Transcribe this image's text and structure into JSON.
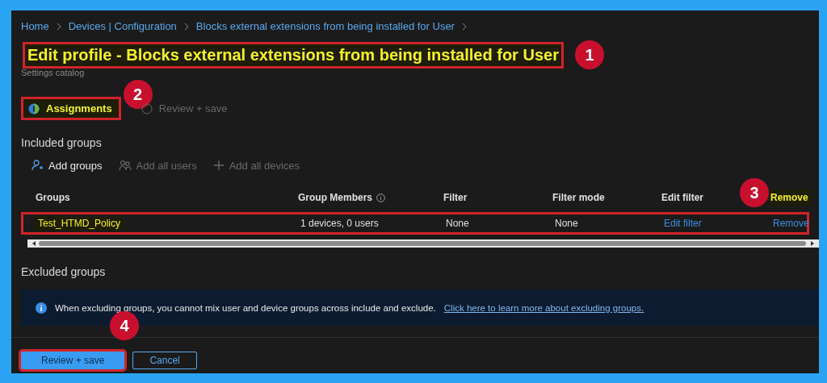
{
  "breadcrumb": [
    {
      "label": "Home"
    },
    {
      "label": "Devices | Configuration"
    },
    {
      "label": "Blocks external extensions from being installed for User"
    }
  ],
  "title": {
    "text": "Edit profile - Blocks external extensions from being installed for User",
    "highlighted": true,
    "boxed": true,
    "callout": "1"
  },
  "subtitle": "Settings catalog",
  "tabs": [
    {
      "label": "Assignments",
      "selected": true,
      "highlighted": true,
      "boxed": true,
      "callout": "2"
    },
    {
      "label": "Review + save",
      "selected": false,
      "highlighted": false,
      "boxed": false
    }
  ],
  "included": {
    "heading": "Included groups",
    "toolbar": [
      {
        "label": "Add groups",
        "kind": "person",
        "disabled": false
      },
      {
        "label": "Add all users",
        "kind": "people",
        "disabled": true
      },
      {
        "label": "Add all devices",
        "kind": "plus",
        "disabled": true
      }
    ],
    "columns": [
      {
        "label": "Groups",
        "highlighted": false
      },
      {
        "label": "Group Members",
        "info": true,
        "highlighted": false
      },
      {
        "label": "Filter",
        "highlighted": false
      },
      {
        "label": "Filter mode",
        "highlighted": false
      },
      {
        "label": "Edit filter",
        "highlighted": false,
        "callout": "3"
      },
      {
        "label": "Remove",
        "highlighted": true
      }
    ],
    "rows": [
      {
        "group": "Test_HTMD_Policy",
        "highlighted": true,
        "boxed": true,
        "members": "1 devices, 0 users",
        "filter": "None",
        "filter_mode": "None",
        "edit_filter": "Edit filter",
        "remove": "Remove"
      }
    ]
  },
  "excluded": {
    "heading": "Excluded groups",
    "notice": {
      "text": "When excluding groups, you cannot mix user and device groups across include and exclude.",
      "link": "Click here to learn more about excluding groups."
    }
  },
  "buttons": [
    {
      "label": "Review + save",
      "kind": "primary",
      "boxed": true,
      "callout": "4"
    },
    {
      "label": "Cancel",
      "kind": "secondary",
      "boxed": false
    }
  ]
}
